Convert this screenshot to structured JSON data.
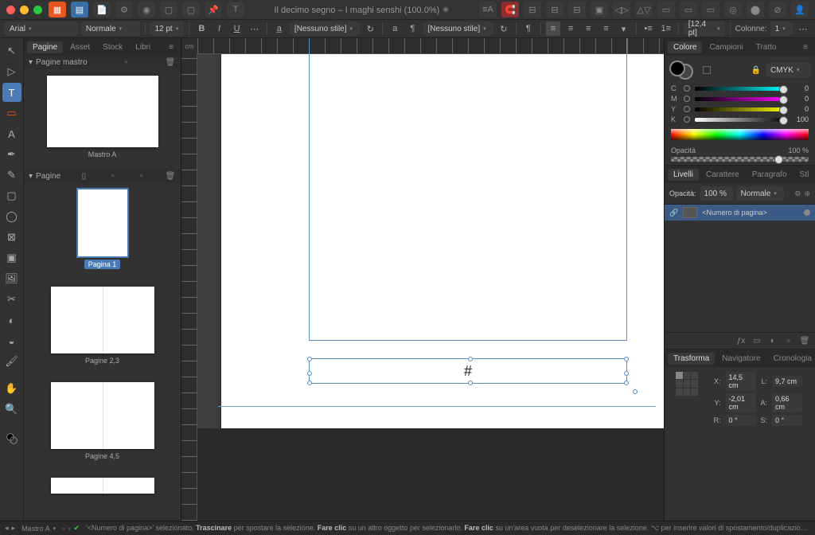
{
  "title": "Il decimo segno – I maghi senshi (100.0%) ✳",
  "propbar": {
    "font": "Arial",
    "style": "Normale",
    "size": "12 pt",
    "nostyle1": "[Nessuno stile]",
    "nostyle2": "[Nessuno stile]",
    "leading": "[12,4 pt]",
    "columns_label": "Colonne:",
    "columns": "1"
  },
  "left_tabs": [
    "Pagine",
    "Asset",
    "Stock",
    "Libri"
  ],
  "master_header": "Pagine mastro",
  "masters": [
    {
      "label": "Mastro A"
    }
  ],
  "pages_header": "Pagine",
  "pages": [
    {
      "label": "Pagina 1",
      "selected": true,
      "type": "single"
    },
    {
      "label": "Pagine 2,3",
      "type": "spread"
    },
    {
      "label": "Pagine 4,5",
      "type": "spread"
    }
  ],
  "canvas": {
    "unit": "cm",
    "placeholder": "#"
  },
  "color_panel": {
    "tabs": [
      "Colore",
      "Campioni",
      "Tratto"
    ],
    "mode": "CMYK",
    "channels": [
      {
        "l": "C",
        "v": "0",
        "cls": "tr-c"
      },
      {
        "l": "M",
        "v": "0",
        "cls": "tr-m"
      },
      {
        "l": "Y",
        "v": "0",
        "cls": "tr-y"
      },
      {
        "l": "K",
        "v": "100",
        "cls": "tr-k"
      }
    ],
    "opacity_label": "Opacità",
    "opacity_value": "100 %"
  },
  "layers_panel": {
    "tabs": [
      "Livelli",
      "Carattere",
      "Paragrafo",
      "Stl"
    ],
    "opacity_label": "Opacità:",
    "opacity_value": "100 %",
    "blend": "Normale",
    "item": "<Numero di pagina>"
  },
  "transform_panel": {
    "tabs": [
      "Trasforma",
      "Navigatore",
      "Cronologia"
    ],
    "x_l": "X:",
    "x": "14,5 cm",
    "y_l": "Y:",
    "y": "-2,01 cm",
    "w_l": "L:",
    "w": "9,7 cm",
    "h_l": "A:",
    "h": "0,66 cm",
    "r_l": "R:",
    "r": "0 °",
    "s_l": "S:",
    "s": "0 °"
  },
  "status": {
    "master": "Mastro A",
    "hint_sel": "'<Numero di pagina>' selezionato.",
    "hint_drag_b": "Trascinare",
    "hint_drag": "per spostare la selezione.",
    "hint_click_b": "Fare clic",
    "hint_click": "su un altro oggetto per selezionarlo.",
    "hint_click2_b": "Fare clic",
    "hint_click2": "su un'area vuota per deselezionare la selezione.",
    "hint_alt": "⌥ per inserire valori di spostamento/duplicazione."
  }
}
